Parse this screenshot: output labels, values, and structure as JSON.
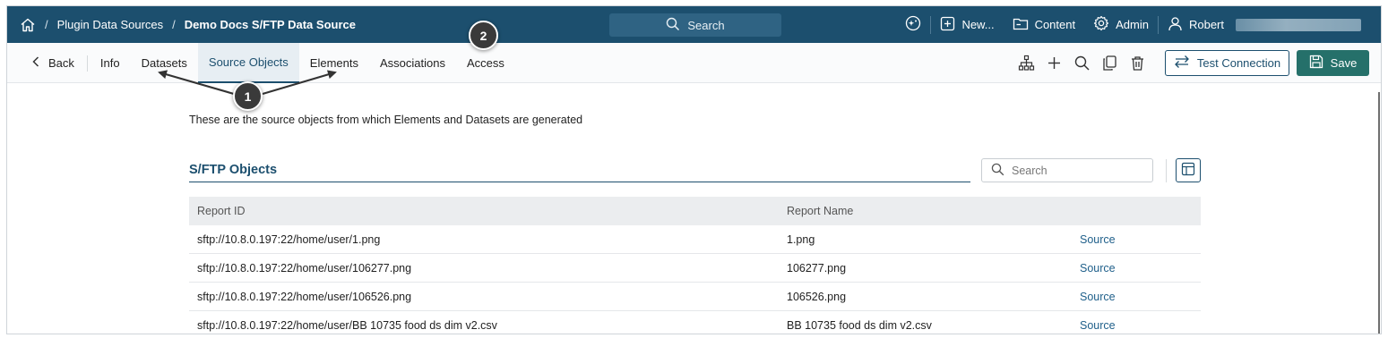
{
  "topbar": {
    "breadcrumb_parent": "Plugin Data Sources",
    "breadcrumb_separator": "/",
    "breadcrumb_current": "Demo Docs S/FTP Data Source",
    "search_label": "Search",
    "new_label": "New...",
    "content_label": "Content",
    "admin_label": "Admin",
    "user_label": "Robert"
  },
  "toolbar": {
    "back_label": "Back",
    "tabs": [
      "Info",
      "Datasets",
      "Source Objects",
      "Elements",
      "Associations",
      "Access"
    ],
    "active_tab": "Source Objects",
    "test_connection_label": "Test Connection",
    "save_label": "Save"
  },
  "main": {
    "description": "These are the source objects from which Elements and Datasets are generated",
    "section_title": "S/FTP Objects",
    "search_placeholder": "Search",
    "columns": [
      "Report ID",
      "Report Name",
      ""
    ],
    "rows": [
      {
        "id": "sftp://10.8.0.197:22/home/user/1.png",
        "name": "1.png",
        "link": "Source"
      },
      {
        "id": "sftp://10.8.0.197:22/home/user/106277.png",
        "name": "106277.png",
        "link": "Source"
      },
      {
        "id": "sftp://10.8.0.197:22/home/user/106526.png",
        "name": "106526.png",
        "link": "Source"
      },
      {
        "id": "sftp://10.8.0.197:22/home/user/BB 10735 food ds dim v2.csv",
        "name": "BB 10735 food ds dim v2.csv",
        "link": "Source"
      }
    ]
  },
  "callouts": {
    "one": "1",
    "two": "2"
  },
  "colors": {
    "header": "#1c4f6e",
    "save": "#25706a",
    "link": "#1f5f8a"
  }
}
